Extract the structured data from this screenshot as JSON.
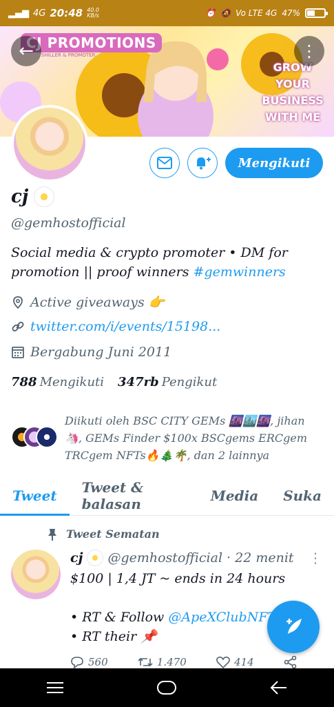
{
  "status_bar": {
    "signal_left": "4G",
    "time": "20:48",
    "speed": "40.0\nKB/s",
    "right_labels": "Vo LTE 4G",
    "battery": "47%",
    "battery_level": 0.47
  },
  "banner": {
    "title": "CJ PROMOTIONS",
    "subtitle": "SHILLER & PROMOTER",
    "cta": "GROW YOUR BUSINESS WITH ME"
  },
  "profile": {
    "follow_label": "Mengikuti",
    "name": "cj",
    "handle": "@gemhostofficial",
    "bio_text": "Social media & crypto promoter • DM for promotion || proof winners ",
    "bio_hashtag": "#gemwinners",
    "location": "Active giveaways 👉",
    "link": "twitter.com/i/events/15198...",
    "joined": "Bergabung Juni 2011",
    "following_count": "788",
    "following_label": "Mengikuti",
    "followers_count": "347rb",
    "followers_label": "Pengikut",
    "followed_by": "Diikuti oleh BSC CITY GEMs 🌆🏙️🌆, jihan 🦄, GEMs Finder $100x BSCgems ERCgem TRCgem NFTs🔥🎄🌴, dan 2 lainnya"
  },
  "tabs": [
    "Tweet",
    "Tweet & balasan",
    "Media",
    "Suka"
  ],
  "pinned_tweet": {
    "pinned_label": "Tweet Sematan",
    "name": "cj",
    "handle": "@gemhostofficial",
    "time": "· 22 menit",
    "line1": "$100 | 1,4 JT ~ ends in 24 hours",
    "line2_prefix": "• RT & Follow ",
    "line2_mention": "@ApeXClubNFT",
    "line3": "• RT their 📌",
    "replies": "560",
    "retweets": "1.470",
    "likes": "414"
  },
  "colors": {
    "accent": "#1d9bf0",
    "status_bar": "#b88214"
  }
}
